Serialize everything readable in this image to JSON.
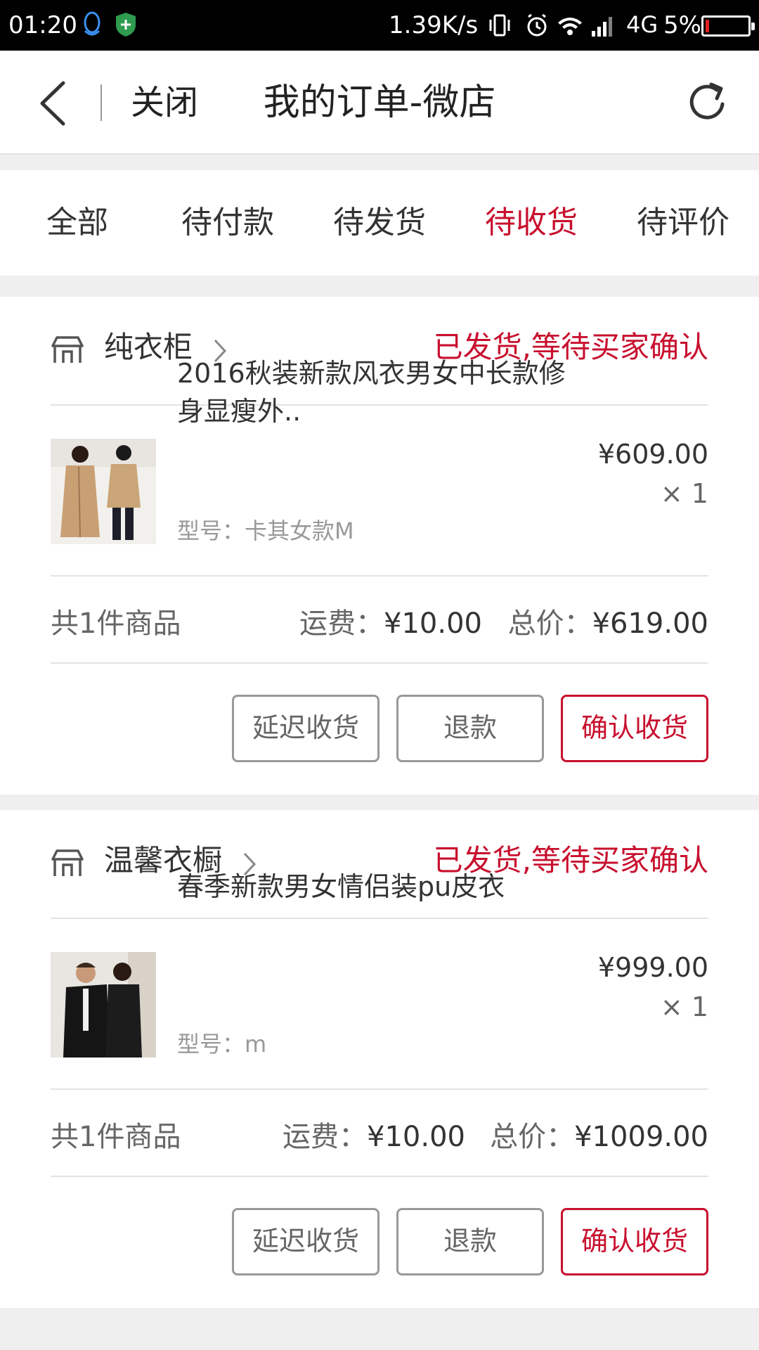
{
  "status_bar": {
    "time": "01:20",
    "speed": "1.39K/s",
    "network": "4G",
    "battery": "5%"
  },
  "header": {
    "close_label": "关闭",
    "title": "我的订单-微店"
  },
  "tabs": [
    {
      "label": "全部",
      "active": false
    },
    {
      "label": "待付款",
      "active": false
    },
    {
      "label": "待发货",
      "active": false
    },
    {
      "label": "待收货",
      "active": true
    },
    {
      "label": "待评价",
      "active": false
    }
  ],
  "orders": [
    {
      "shop_name": "纯衣柜",
      "status": "已发货,等待买家确认",
      "item": {
        "title": "2016秋装新款风衣男女中长款修身显瘦外..",
        "model": "型号：卡其女款M",
        "price": "¥609.00",
        "qty": "× 1"
      },
      "count_text": "共1件商品",
      "freight_label": "运费：",
      "freight_value": "¥10.00",
      "total_label": "总价：",
      "total_value": "¥619.00",
      "buttons": {
        "delay": "延迟收货",
        "refund": "退款",
        "confirm": "确认收货"
      }
    },
    {
      "shop_name": "温馨衣橱",
      "status": "已发货,等待买家确认",
      "item": {
        "title": "春季新款男女情侣装pu皮衣",
        "model": "型号：m",
        "price": "¥999.00",
        "qty": "× 1"
      },
      "count_text": "共1件商品",
      "freight_label": "运费：",
      "freight_value": "¥10.00",
      "total_label": "总价：",
      "total_value": "¥1009.00",
      "buttons": {
        "delay": "延迟收货",
        "refund": "退款",
        "confirm": "确认收货"
      }
    }
  ],
  "colors": {
    "accent": "#c8102e",
    "background": "#efefef"
  }
}
